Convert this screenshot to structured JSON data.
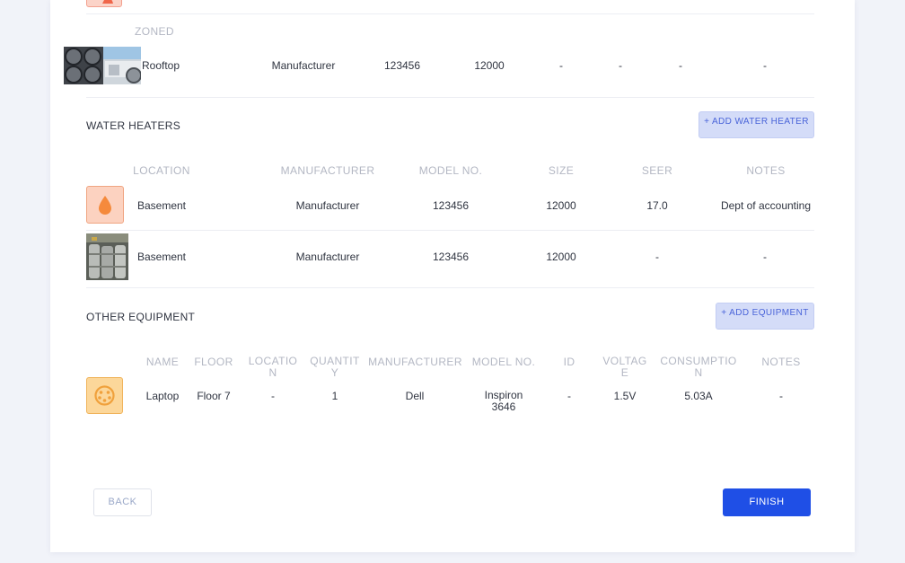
{
  "hvac": {
    "zone_header": "ZONED",
    "row": {
      "location": "Rooftop",
      "manufacturer": "Manufacturer",
      "model_no": "123456",
      "size": "12000",
      "col5": "-",
      "col6": "-",
      "col7": "-",
      "notes": "-"
    }
  },
  "water_heaters": {
    "title": "WATER HEATERS",
    "add_label": "+ ADD WATER HEATER",
    "headers": {
      "location": "LOCATION",
      "manufacturer": "MANUFACTURER",
      "model_no": "MODEL NO.",
      "size": "SIZE",
      "seer": "SEER",
      "notes": "NOTES"
    },
    "rows": [
      {
        "icon": "water-drop-icon",
        "location": "Basement",
        "manufacturer": "Manufacturer",
        "model_no": "123456",
        "size": "12000",
        "seer": "17.0",
        "notes": "Dept of accounting"
      },
      {
        "icon": "water-heater-photo",
        "location": "Basement",
        "manufacturer": "Manufacturer",
        "model_no": "123456",
        "size": "12000",
        "seer": "-",
        "notes": "-"
      }
    ]
  },
  "other_equipment": {
    "title": "OTHER EQUIPMENT",
    "add_label": "+ ADD EQUIPMENT",
    "headers": {
      "name": "NAME",
      "floor": "FLOOR",
      "location": "LOCATIO N",
      "quantity": "QUANTIT Y",
      "manufacturer": "MANUFACTURER",
      "model_no": "MODEL NO.",
      "id": "ID",
      "voltage": "VOLTAG E",
      "consumption": "CONSUMPTIO N",
      "notes": "NOTES"
    },
    "rows": [
      {
        "icon": "outlet-icon",
        "name": "Laptop",
        "floor": "Floor 7",
        "location": "-",
        "quantity": "1",
        "manufacturer": "Dell",
        "model_no": "Inspiron 3646",
        "id": "-",
        "voltage": "1.5V",
        "consumption": "5.03A",
        "notes": "-"
      }
    ]
  },
  "footer": {
    "back_label": "BACK",
    "finish_label": "FINISH"
  },
  "colors": {
    "accent": "#1f4fe6",
    "icon_orange": "#f58a3c",
    "icon_yellow": "#f5b63c"
  }
}
